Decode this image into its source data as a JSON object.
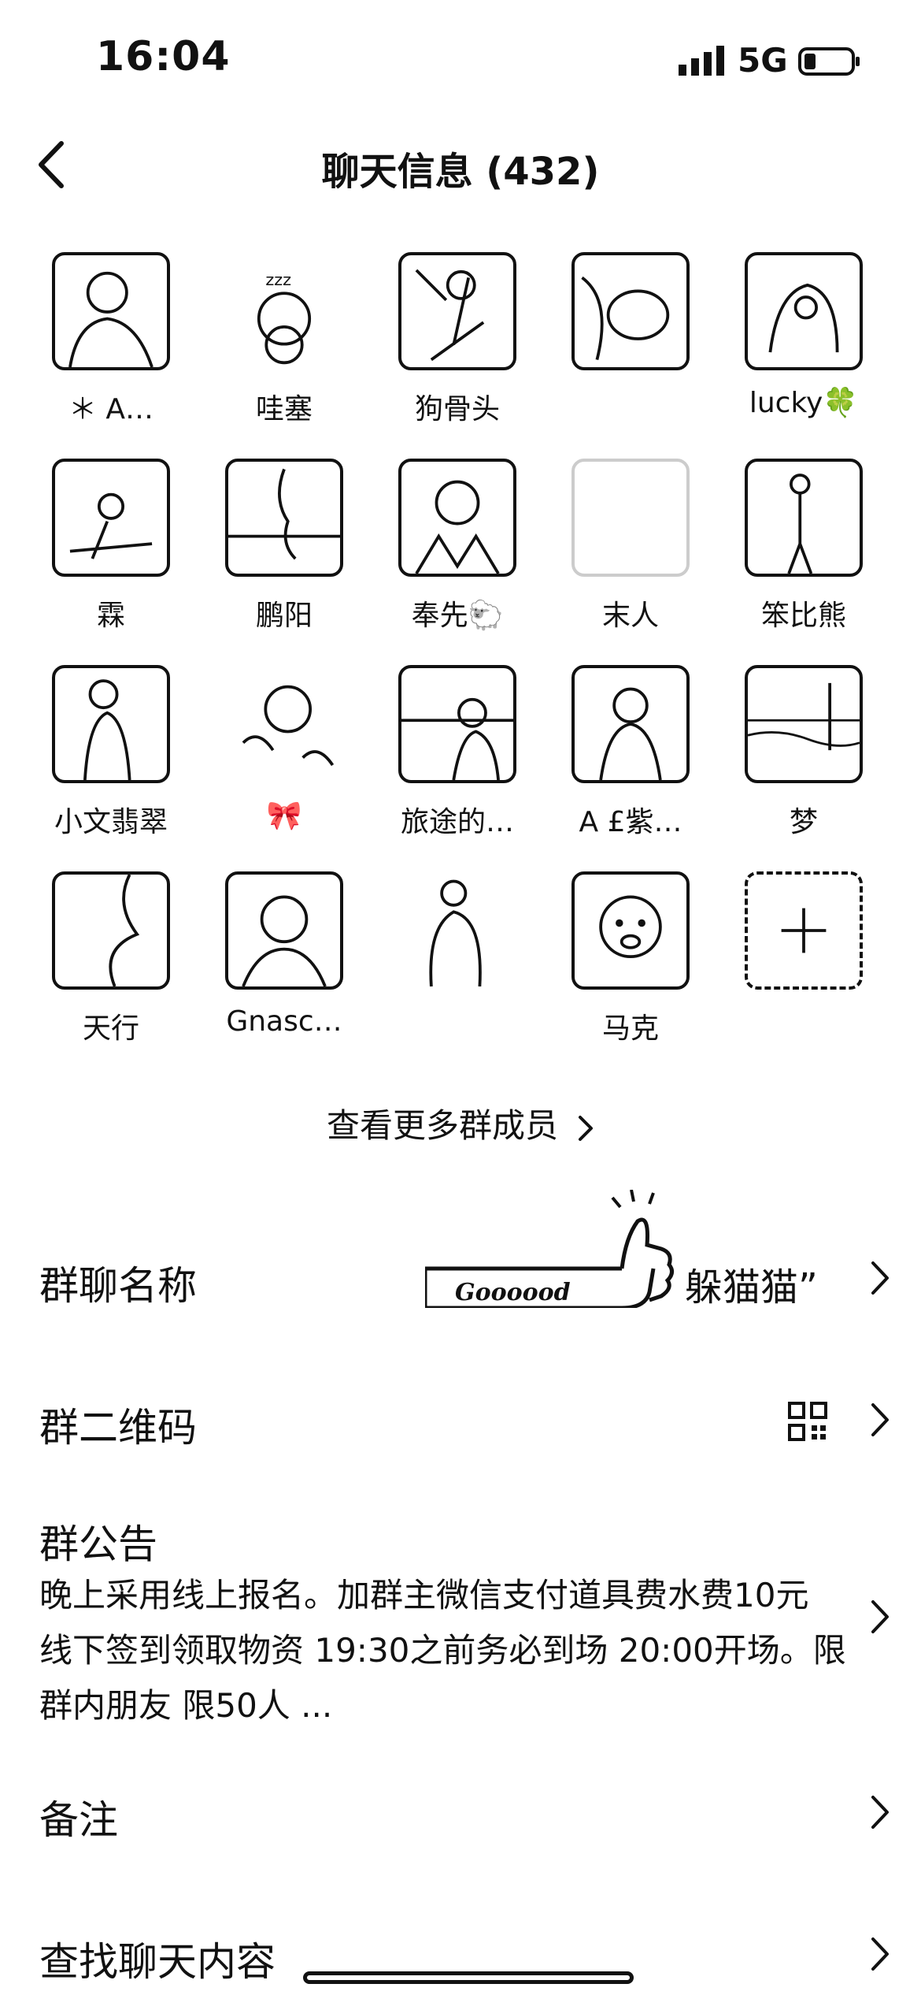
{
  "status": {
    "time": "16:04",
    "network": "5G"
  },
  "nav": {
    "title": "聊天信息 (432)"
  },
  "members": [
    {
      "name": "＊ A…"
    },
    {
      "name": "哇塞"
    },
    {
      "name": "狗骨头"
    },
    {
      "name": ""
    },
    {
      "name": "lucky🍀"
    },
    {
      "name": "霖"
    },
    {
      "name": "鹏阳"
    },
    {
      "name": "奉先🐑"
    },
    {
      "name": "末人"
    },
    {
      "name": "笨比熊"
    },
    {
      "name": "小文翡翠"
    },
    {
      "name": "🎀"
    },
    {
      "name": "旅途的…"
    },
    {
      "name": "A £紫…"
    },
    {
      "name": "梦"
    },
    {
      "name": "天行"
    },
    {
      "name": "Gnasc…"
    },
    {
      "name": ""
    },
    {
      "name": "马克"
    }
  ],
  "more_members": "查看更多群成员",
  "settings": {
    "group_name_label": "群聊名称",
    "group_name_value": "躲猫猫”",
    "sticker_text": "Goooood",
    "qr_label": "群二维码",
    "notice_label": "群公告",
    "notice_text": "晚上采用线上报名。加群主微信支付道具费水费10元 线下签到领取物资 19:30之前务必到场 20:00开场。限群内朋友 限50人 ...",
    "remark_label": "备注",
    "search_label": "查找聊天内容"
  }
}
